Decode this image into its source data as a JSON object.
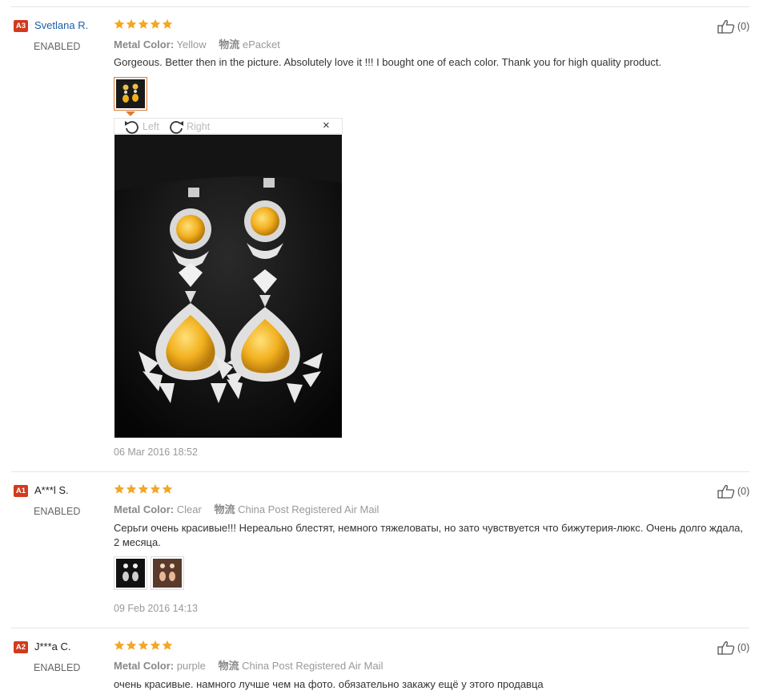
{
  "reviews": [
    {
      "badge": "A3",
      "name": "Svetlana R.",
      "status": "ENABLED",
      "attr_label": "Metal Color:",
      "attr_value": "Yellow",
      "ship_label": "物流",
      "ship_value": "ePacket",
      "text": "Gorgeous. Better then in the picture. Absolutely love it !!! I bought one of each color. Thank you for high quality product.",
      "date": "06 Mar 2016 18:52",
      "likes": "(0)",
      "rating": 5,
      "viewer": {
        "left_label": "Left",
        "right_label": "Right",
        "close": "×"
      }
    },
    {
      "badge": "A1",
      "name": "A***l S.",
      "status": "ENABLED",
      "attr_label": "Metal Color:",
      "attr_value": "Clear",
      "ship_label": "物流",
      "ship_value": "China Post Registered Air Mail",
      "text": "Серьги очень красивые!!! Нереально блестят, немного тяжеловаты, но зато чувствуется что бижутерия-люкс. Очень долго ждала, 2 месяца.",
      "date": "09 Feb 2016 14:13",
      "likes": "(0)",
      "rating": 5
    },
    {
      "badge": "A2",
      "name": "J***a C.",
      "status": "ENABLED",
      "attr_label": "Metal Color:",
      "attr_value": "purple",
      "ship_label": "物流",
      "ship_value": "China Post Registered Air Mail",
      "text": "очень красивые. намного лучше чем на фото. обязательно закажу ещё у этого продавца",
      "likes": "(0)",
      "rating": 5
    }
  ],
  "colors": {
    "badge": "#d23a1e",
    "star": "#f5a623",
    "link": "#1a5fa8",
    "accent": "#e07b2e"
  },
  "icons": {
    "like": "thumbs-up-icon",
    "rotate_left": "rotate-left-icon",
    "rotate_right": "rotate-right-icon",
    "close": "close-icon",
    "star": "star-icon"
  }
}
